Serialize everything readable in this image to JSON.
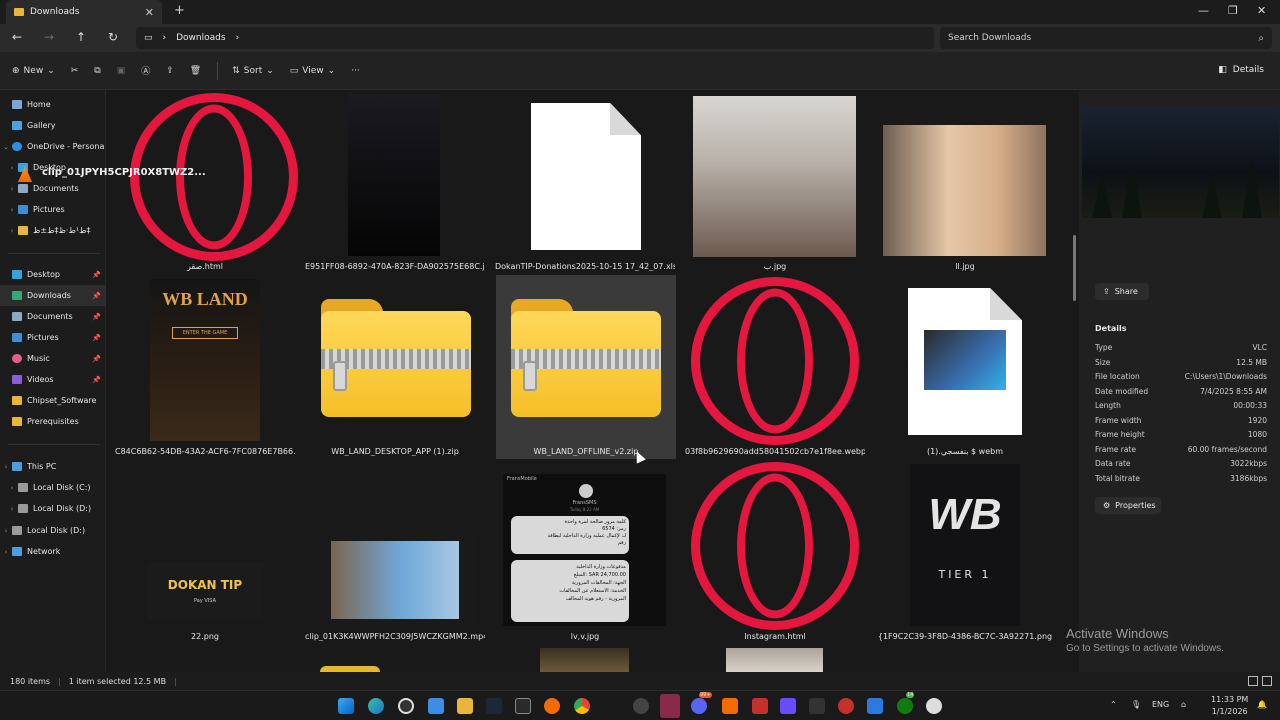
{
  "window": {
    "tab_title": "Downloads"
  },
  "nav": {
    "breadcrumb": "Downloads",
    "search_placeholder": "Search Downloads"
  },
  "toolbar": {
    "new": "New",
    "sort": "Sort",
    "view": "View",
    "more": "···",
    "details": "Details"
  },
  "sidebar": {
    "home": "Home",
    "gallery": "Gallery",
    "onedrive": "OneDrive - Persona",
    "od_desktop": "Desktop",
    "od_documents": "Documents",
    "od_pictures": "Pictures",
    "od_folder": "ط¹ط·ظ‡ط±ظ‡",
    "q_desktop": "Desktop",
    "q_downloads": "Downloads",
    "q_documents": "Documents",
    "q_pictures": "Pictures",
    "q_music": "Music",
    "q_videos": "Videos",
    "q_chipset": "Chipset_Software",
    "q_prereq": "Prerequisites",
    "thispc": "This PC",
    "disk_c": "Local Disk (C:)",
    "disk_d1": "Local Disk (D:)",
    "disk_d2": "Local Disk (D:)",
    "network": "Network"
  },
  "files": [
    {
      "name": "صقر.html"
    },
    {
      "name": "E951FF08-6892-470A-823F-DA902575E68C.jpg"
    },
    {
      "name": "DokanTIP-Donations2025-10-15 17_42_07.xlsx"
    },
    {
      "name": "ب.jpg"
    },
    {
      "name": "ll.jpg"
    },
    {
      "name": "C84C6B62-54DB-43A2-ACF6-7FC0876E7B66.png",
      "thumb_title": "WB LAND",
      "thumb_button": "ENTER THE GAME"
    },
    {
      "name": "WB_LAND_DESKTOP_APP (1).zip"
    },
    {
      "name": "WB_LAND_OFFLINE_v2.zip"
    },
    {
      "name": "03f8b9629690add58041502cb7e1f8ee.webp"
    },
    {
      "name": "(1).بنفسجي $ webm"
    },
    {
      "name": "22.png",
      "thumb_title": "DOKAN TIP",
      "thumb_sub": "Pay  VISA"
    },
    {
      "name": "clip_01K3K4WWPFH2C309J5WCZKGMM2.mp4"
    },
    {
      "name": "lv,v.jpg",
      "thumb_header": "FransMobile",
      "thumb_name": "FransSMS",
      "thumb_time": "Today 8:22 AM",
      "thumb_msg1": "كلمة مرور صالحة لمرة واحدة\nرمز: 6574\nلـ: لإكمال عملية وزارة الداخلية لبطاقة\nرقم",
      "thumb_msg2": "مدفوعات وزارة الداخلية\nالمبلغ: SAR 24,700.00\nالجهة: المخالفات المرورية\nالخدمة: الاستعلام عن المخالفات\nالمرورية - رقم هوية المخالف"
    },
    {
      "name": "Instagram.html"
    },
    {
      "name": "{1F9C2C39-3F8D-4386-BC7C-3A92271.png",
      "thumb_title": "WB",
      "thumb_sub": "TIER 1"
    }
  ],
  "details": {
    "title": "clip_01JPYH5CPJR0X8TWZ2...",
    "share": "Share",
    "section": "Details",
    "rows": [
      {
        "k": "Type",
        "v": "VLC"
      },
      {
        "k": "Size",
        "v": "12.5 MB"
      },
      {
        "k": "File location",
        "v": "C:\\Users\\1\\Downloads"
      },
      {
        "k": "Date modified",
        "v": "7/4/2025 8:55 AM"
      },
      {
        "k": "Length",
        "v": "00:00:33"
      },
      {
        "k": "Frame width",
        "v": "1920"
      },
      {
        "k": "Frame height",
        "v": "1080"
      },
      {
        "k": "Frame rate",
        "v": "60.00 frames/second"
      },
      {
        "k": "Data rate",
        "v": "3022kbps"
      },
      {
        "k": "Total bitrate",
        "v": "3186kbps"
      }
    ],
    "properties": "Properties"
  },
  "watermark": {
    "line1": "Activate Windows",
    "line2": "Go to Settings to activate Windows."
  },
  "status": {
    "items": "180 items",
    "selected": "1 item selected  12.5 MB"
  },
  "tray": {
    "lang": "ENG",
    "time": "11:33 PM",
    "date": "1/1/2026",
    "badge1": "99+",
    "badge2": "14"
  },
  "colors": {
    "opera": "#e5173f",
    "folder": "#f5bf28",
    "accent": "#4cc2ff"
  }
}
